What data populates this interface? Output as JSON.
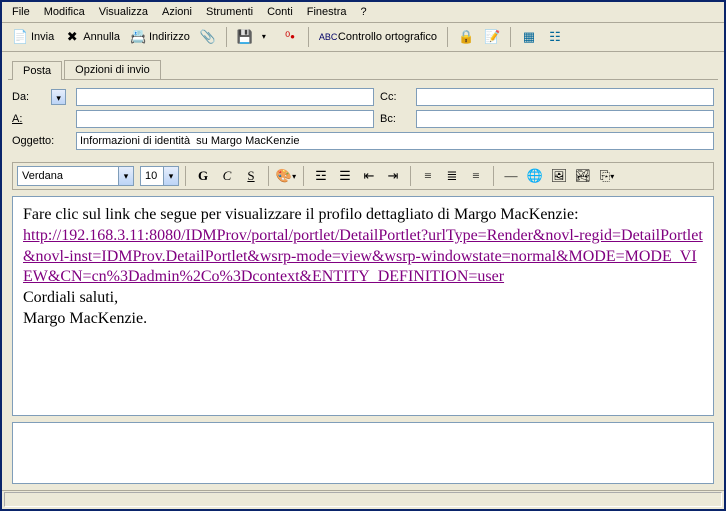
{
  "menu": {
    "file": "File",
    "modifica": "Modifica",
    "visualizza": "Visualizza",
    "azioni": "Azioni",
    "strumenti": "Strumenti",
    "conti": "Conti",
    "finestra": "Finestra",
    "help": "?"
  },
  "toolbar": {
    "invia": "Invia",
    "annulla": "Annulla",
    "indirizzo": "Indirizzo",
    "ortografia": "Controllo ortografico"
  },
  "tabs": {
    "posta": "Posta",
    "opzioni": "Opzioni di invio"
  },
  "fields": {
    "da_label": "Da:",
    "a_label": "A:",
    "cc_label": "Cc:",
    "bc_label": "Bc:",
    "oggetto_label": "Oggetto:",
    "da": "",
    "a": "",
    "cc": "",
    "bc": "",
    "oggetto": "Informazioni di identità  su Margo MacKenzie"
  },
  "format": {
    "font": "Verdana",
    "size": "10"
  },
  "body": {
    "line1": "Fare clic sul link che segue per visualizzare il profilo dettagliato di Margo MacKenzie:",
    "link": "http://192.168.3.11:8080/IDMProv/portal/portlet/DetailPortlet?urlType=Render&novl-regid=DetailPortlet&novl-inst=IDMProv.DetailPortlet&wsrp-mode=view&wsrp-windowstate=normal&MODE=MODE_VIEW&CN=cn%3Dadmin%2Co%3Dcontext&ENTITY_DEFINITION=user",
    "sig1": "Cordiali saluti,",
    "sig2": "Margo MacKenzie."
  }
}
